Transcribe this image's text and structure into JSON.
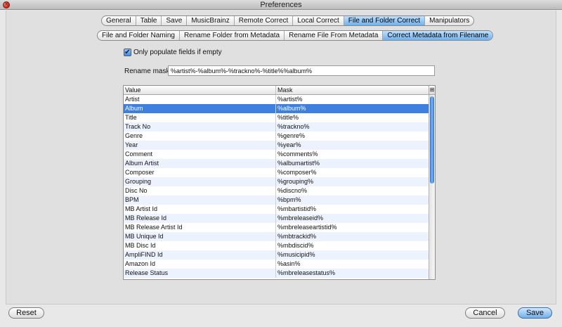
{
  "window": {
    "title": "Preferences"
  },
  "main_tabs": [
    {
      "label": "General",
      "active": false
    },
    {
      "label": "Table",
      "active": false
    },
    {
      "label": "Save",
      "active": false
    },
    {
      "label": "MusicBrainz",
      "active": false
    },
    {
      "label": "Remote Correct",
      "active": false
    },
    {
      "label": "Local Correct",
      "active": false
    },
    {
      "label": "File and Folder Correct",
      "active": true
    },
    {
      "label": "Manipulators",
      "active": false
    }
  ],
  "sub_tabs": [
    {
      "label": "File and Folder Naming",
      "active": false
    },
    {
      "label": "Rename Folder from Metadata",
      "active": false
    },
    {
      "label": "Rename File From Metadata",
      "active": false
    },
    {
      "label": "Correct Metadata from Filename",
      "active": true
    }
  ],
  "options": {
    "populate_if_empty_label": "Only populate fields if empty",
    "populate_if_empty_checked": true
  },
  "rename_mask": {
    "label": "Rename mask",
    "value": "%artist%-%album%-%trackno%-%title%%album%"
  },
  "table": {
    "columns": [
      "Value",
      "Mask"
    ],
    "selected_row": 1,
    "rows": [
      [
        "Artist",
        "%artist%"
      ],
      [
        "Album",
        "%album%"
      ],
      [
        "Title",
        "%title%"
      ],
      [
        "Track No",
        "%trackno%"
      ],
      [
        "Genre",
        "%genre%"
      ],
      [
        "Year",
        "%year%"
      ],
      [
        "Comment",
        "%comments%"
      ],
      [
        "Album Artist",
        "%albumartist%"
      ],
      [
        "Composer",
        "%composer%"
      ],
      [
        "Grouping",
        "%grouping%"
      ],
      [
        "Disc No",
        "%discno%"
      ],
      [
        "BPM",
        "%bpm%"
      ],
      [
        "MB Artist Id",
        "%mbartistid%"
      ],
      [
        "MB Release Id",
        "%mbreleaseid%"
      ],
      [
        "MB Release Artist Id",
        "%mbreleaseartistid%"
      ],
      [
        "MB Unique Id",
        "%mbtrackid%"
      ],
      [
        "MB Disc Id",
        "%mbdiscid%"
      ],
      [
        "AmpliFIND Id",
        "%musicipid%"
      ],
      [
        "Amazon Id",
        "%asin%"
      ],
      [
        "Release Status",
        "%mbreleasestatus%"
      ]
    ]
  },
  "buttons": {
    "reset": "Reset",
    "cancel": "Cancel",
    "save": "Save"
  },
  "colors": {
    "selection": "#3d80df",
    "active_tab": "#6fb0ec"
  }
}
